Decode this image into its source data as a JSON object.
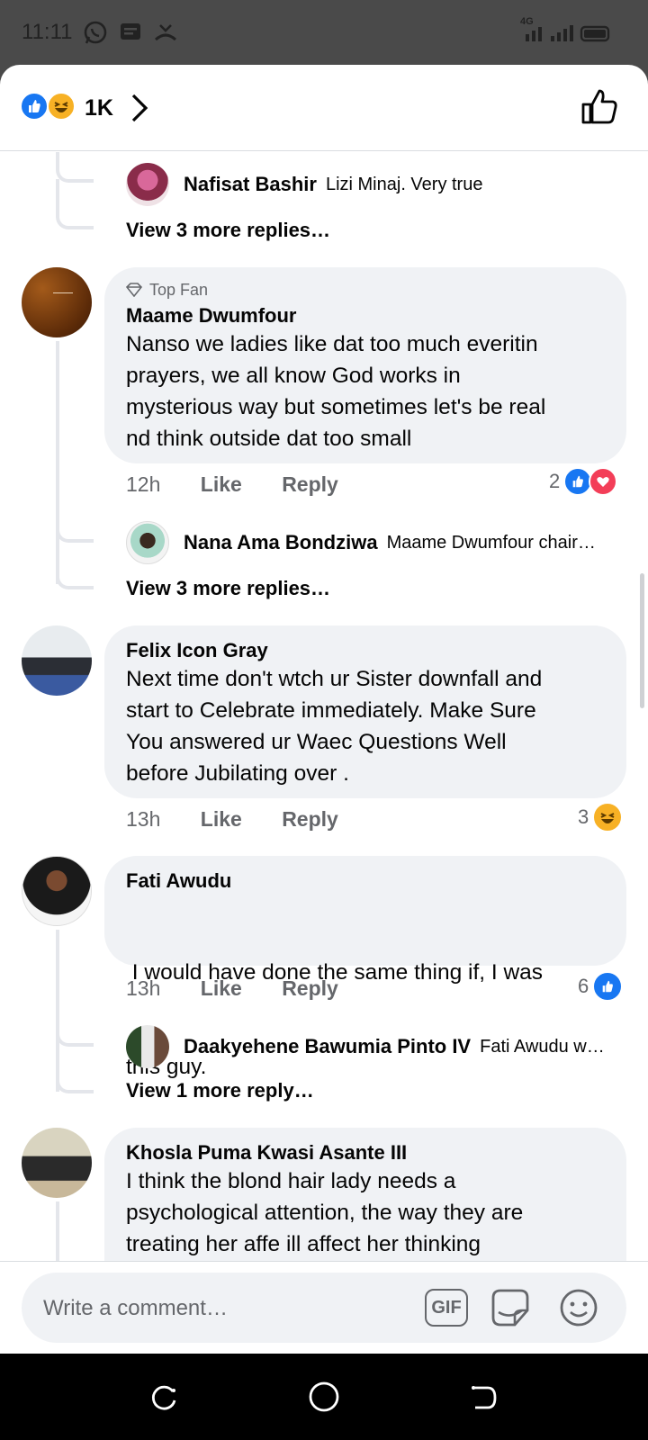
{
  "status_bar": {
    "time": "11:11",
    "network": "4G"
  },
  "header": {
    "reaction_count": "1K"
  },
  "thread1": {
    "reply": {
      "name": "Nafisat Bashir",
      "text": "Lizi Minaj. Very true"
    },
    "more": "View 3 more replies…"
  },
  "comments": [
    {
      "badge": "Top Fan",
      "name": "Maame Dwumfour",
      "lines": [
        "Nanso we ladies like dat too much everitin",
        "prayers, we all know God works in",
        "mysterious way but sometimes let's be real",
        "nd think outside dat too small"
      ],
      "time": "12h",
      "like": "Like",
      "reply": "Reply",
      "reaction_count": "2",
      "sub_reply": {
        "name": "Nana Ama Bondziwa",
        "text": "Maame Dwumfour chair…"
      },
      "more": "View 3 more replies…"
    },
    {
      "name": "Felix Icon Gray",
      "lines": [
        "Next time don't wtch ur Sister downfall and",
        "start to Celebrate immediately. Make Sure",
        "You answered ur Waec Questions Well",
        "before Jubilating over ."
      ],
      "time": "13h",
      "like": "Like",
      "reply": "Reply",
      "reaction_count": "3"
    },
    {
      "name": "Fati Awudu",
      "lines": [
        " I would have done the same thing if, I was",
        "this guy."
      ],
      "time": "13h",
      "like": "Like",
      "reply": "Reply",
      "reaction_count": "6",
      "sub_reply": {
        "name": "Daakyehene Bawumia Pinto IV",
        "text": "Fati Awudu w…"
      },
      "more": "View 1 more reply…"
    },
    {
      "name": "Khosla Puma Kwasi Asante III",
      "lines": [
        "I think the blond hair lady needs a",
        "psychological attention, the way they are",
        "treating her affe ill affect her thinking"
      ]
    }
  ],
  "composer": {
    "placeholder": "Write a comment…",
    "gif_label": "GIF"
  },
  "colors": {
    "accent": "#1877f2",
    "love": "#f33e58",
    "haha": "#f7b125"
  }
}
